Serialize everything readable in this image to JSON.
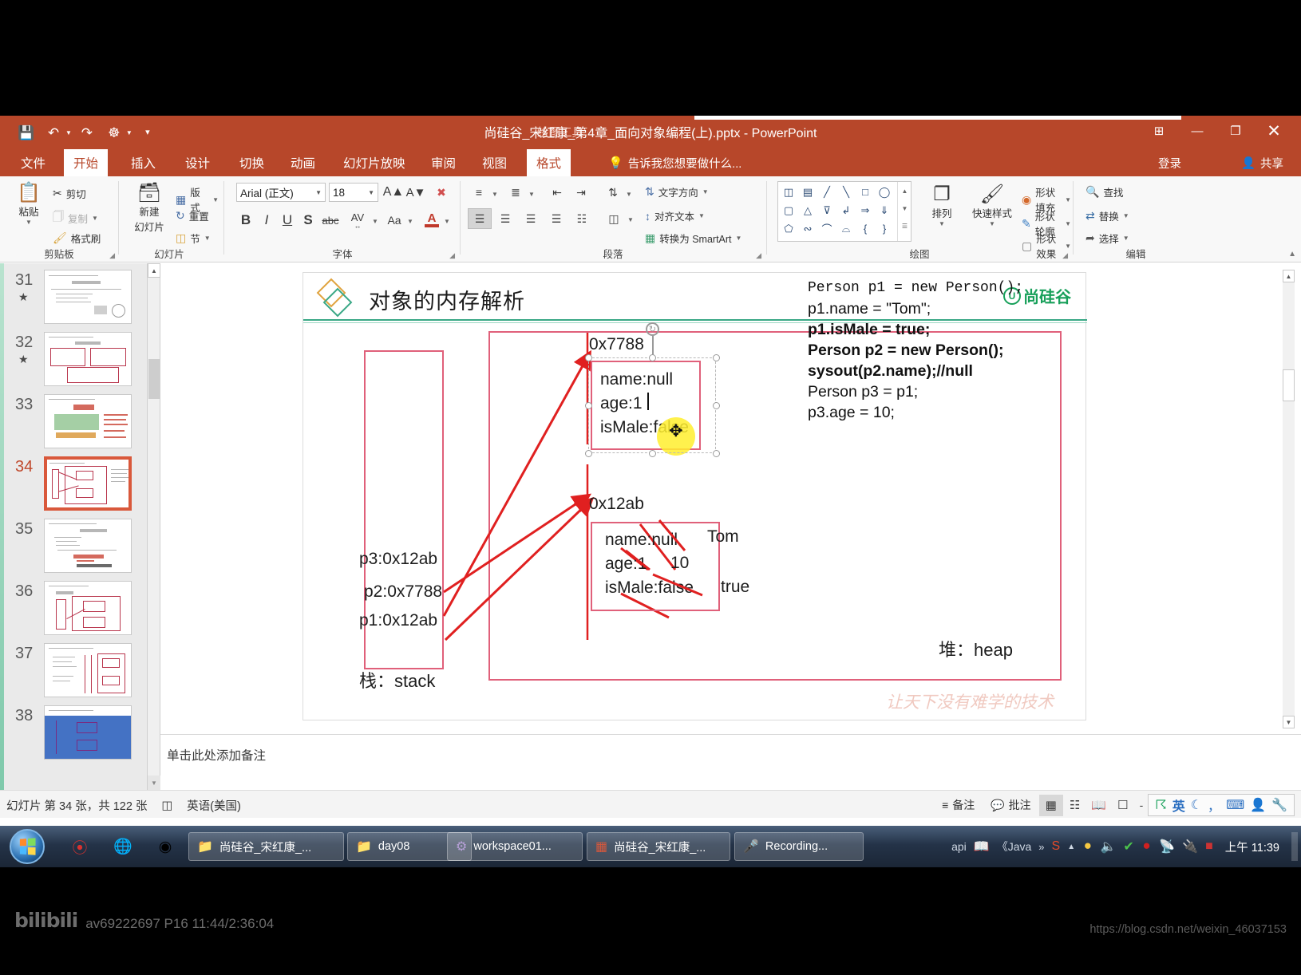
{
  "window": {
    "title": "尚硅谷_宋红康_第4章_面向对象编程(上).pptx - PowerPoint",
    "contextual_tab_group": "绘图工具",
    "quick_access": [
      "save-icon",
      "undo-icon",
      "redo-icon",
      "start-presentation-icon",
      "customize-icon"
    ],
    "signin": "登录",
    "share": "共享",
    "minimize": "—",
    "restore": "❐",
    "close": "✕",
    "ribbon_display": "⊞"
  },
  "tabs": [
    {
      "label": "文件",
      "active": false
    },
    {
      "label": "开始",
      "active": true
    },
    {
      "label": "插入",
      "active": false
    },
    {
      "label": "设计",
      "active": false
    },
    {
      "label": "切换",
      "active": false
    },
    {
      "label": "动画",
      "active": false
    },
    {
      "label": "幻灯片放映",
      "active": false
    },
    {
      "label": "审阅",
      "active": false
    },
    {
      "label": "视图",
      "active": false
    },
    {
      "label": "格式",
      "active": true
    }
  ],
  "tell_me": {
    "placeholder": "告诉我您想要做什么..."
  },
  "ribbon": {
    "groups": [
      {
        "name": "剪贴板"
      },
      {
        "name": "幻灯片"
      },
      {
        "name": "字体"
      },
      {
        "name": "段落"
      },
      {
        "name": "绘图"
      },
      {
        "name": "编辑"
      }
    ],
    "clipboard": {
      "paste": "粘贴",
      "cut": "剪切",
      "copy": "复制",
      "format_painter": "格式刷"
    },
    "slides": {
      "new_slide": "新建",
      "new_slide2": "幻灯片",
      "layout": "版式",
      "reset": "重置",
      "section": "节"
    },
    "font": {
      "family": "Arial (正文)",
      "size": "18",
      "grow": "A",
      "shrink": "A",
      "clear_formatting": "clear-format-icon",
      "bold": "B",
      "italic": "I",
      "underline": "U",
      "shadow": "S",
      "strikethrough": "abc",
      "char_spacing": "AV",
      "change_case": "Aa",
      "font_color": "A"
    },
    "paragraph": {
      "text_direction": "文字方向",
      "align_text": "对齐文本",
      "smartart": "转换为 SmartArt"
    },
    "drawing": {
      "arrange": "排列",
      "quick_styles": "快速样式",
      "shape_fill": "形状填充",
      "shape_outline": "形状轮廓",
      "shape_effects": "形状效果"
    },
    "editing": {
      "find": "查找",
      "replace": "替换",
      "select": "选择"
    }
  },
  "thumbnails": [
    {
      "num": "31",
      "starred": true,
      "selected": false
    },
    {
      "num": "32",
      "starred": true,
      "selected": false
    },
    {
      "num": "33",
      "starred": false,
      "selected": false
    },
    {
      "num": "34",
      "starred": false,
      "selected": true
    },
    {
      "num": "35",
      "starred": false,
      "selected": false
    },
    {
      "num": "36",
      "starred": false,
      "selected": false
    },
    {
      "num": "37",
      "starred": false,
      "selected": false
    },
    {
      "num": "38",
      "starred": false,
      "selected": false
    }
  ],
  "slide": {
    "title": "对象的内存解析",
    "logo_text": "尚硅谷",
    "watermark": "让天下没有难学的技术",
    "stack_label": "栈：stack",
    "heap_label": "堆：heap",
    "stack_entries": [
      "p3:0x12ab",
      "p2:0x7788",
      "p1:0x12ab"
    ],
    "objects": [
      {
        "address": "0x7788",
        "fields": [
          "name:null",
          "age:1",
          "isMale:false"
        ],
        "selected": true
      },
      {
        "address": "0x12ab",
        "fields": [
          "name:null",
          "age:1",
          "isMale:false"
        ],
        "annotations": [
          "Tom",
          "10",
          "true"
        ],
        "selected": false
      }
    ],
    "code": [
      "Person p1 = new Person();",
      "p1.name = \"Tom\";",
      "p1.isMale = true;",
      "Person p2 = new Person();",
      "sysout(p2.name);//null",
      "Person p3 = p1;",
      "p3.age = 10;"
    ],
    "code_tokens": {
      "l1_a": "Person ",
      "l1_b": "p1",
      "l1_c": " = ",
      "l1_d": "new ",
      "l1_e": "Person();"
    }
  },
  "notes": {
    "placeholder": "单击此处添加备注"
  },
  "status": {
    "slide_counter": "幻灯片 第 34 张，共 122 张",
    "language": "英语(美国)",
    "notes_button": "备注",
    "comments_button": "批注",
    "views": [
      "normal-view-icon",
      "slide-sorter-icon",
      "reading-view-icon",
      "slideshow-icon"
    ],
    "zoom_minus": "-",
    "ime": [
      "ime-logo-icon",
      "英",
      "moon-icon",
      "punctuation-icon",
      "keyboard-icon",
      "user-icon",
      "tools-icon"
    ]
  },
  "taskbar": {
    "quick_launch": [
      "sogou-icon",
      "browser-icon",
      "chrome-icon"
    ],
    "buttons": [
      {
        "label": "尚硅谷_宋红康_...",
        "icon": "folder-icon"
      },
      {
        "label": "day08",
        "icon": "folder-icon"
      },
      {
        "label": "workspace01...",
        "icon": "eclipse-icon"
      },
      {
        "label": "尚硅谷_宋红康_...",
        "icon": "powerpoint-icon"
      },
      {
        "label": "Recording...",
        "icon": "recorder-icon"
      }
    ],
    "tray_text": [
      "api",
      "《Java",
      "»"
    ],
    "clock": "上午 11:39"
  },
  "overlay": {
    "bilibili_logo": "bilibili",
    "bilibili_meta": "av69222697 P16 11:44/2:36:04",
    "csdn": "https://blog.csdn.net/weixin_46037153"
  }
}
